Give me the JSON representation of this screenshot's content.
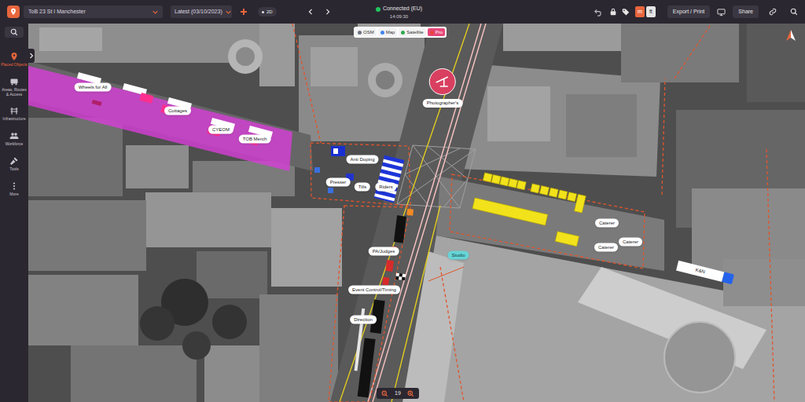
{
  "topbar": {
    "event": "ToB 23 St I Manchester",
    "version": "Latest (03/10/2023)",
    "view_mode": "2D",
    "connection": {
      "label": "Connected (EU)",
      "connected": true,
      "time": "14:09:30"
    },
    "units": [
      {
        "label": "m",
        "selected": true
      },
      {
        "label": "ft",
        "selected": false
      }
    ],
    "export": "Export / Print",
    "share": "Share"
  },
  "map_styles": [
    {
      "label": "OSM",
      "selected": false
    },
    {
      "label": "Map",
      "selected": false
    },
    {
      "label": "Satellite",
      "selected": false
    },
    {
      "label": "Pro",
      "selected": true
    }
  ],
  "sidebar": {
    "items": [
      {
        "label": "Placed Objects",
        "selected": true
      },
      {
        "label": "Areas, Routes & Access",
        "selected": false
      },
      {
        "label": "Infrastructure",
        "selected": false
      },
      {
        "label": "Workforce",
        "selected": false
      },
      {
        "label": "Tools",
        "selected": false
      },
      {
        "label": "More",
        "selected": false
      }
    ]
  },
  "map": {
    "objects": [
      {
        "label": "Wheels for All",
        "kind": "label"
      },
      {
        "label": "Cottages",
        "kind": "label"
      },
      {
        "label": "CYEOM",
        "kind": "label"
      },
      {
        "label": "TOB Merch",
        "kind": "label"
      },
      {
        "label": "Photographer's",
        "kind": "pin"
      },
      {
        "label": "Anti Doping",
        "kind": "label"
      },
      {
        "label": "Presser",
        "kind": "label"
      },
      {
        "label": "Tills",
        "kind": "label"
      },
      {
        "label": "Riders",
        "kind": "label"
      },
      {
        "label": "PA/Judges",
        "kind": "label"
      },
      {
        "label": "Studio",
        "kind": "tag"
      },
      {
        "label": "Event Control/Timing",
        "kind": "label"
      },
      {
        "label": "Direction",
        "kind": "label"
      },
      {
        "label": "Caterer",
        "kind": "label"
      },
      {
        "label": "Caterer",
        "kind": "label"
      },
      {
        "label": "Caterer",
        "kind": "label"
      },
      {
        "label": "K&N",
        "kind": "vehicle"
      }
    ],
    "zoom": "19"
  }
}
